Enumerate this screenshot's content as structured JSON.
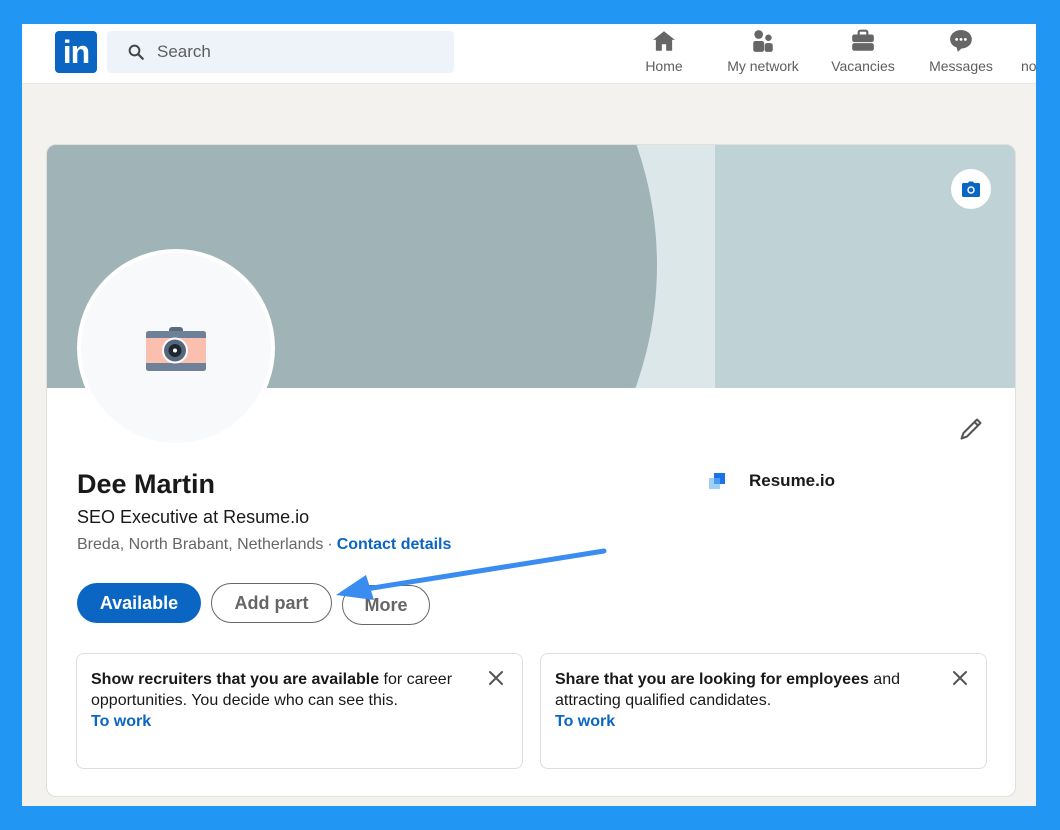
{
  "navbar": {
    "logo_text": "in",
    "search_placeholder": "Search",
    "items": [
      {
        "label": "Home",
        "icon": "home-icon"
      },
      {
        "label": "My network",
        "icon": "network-icon"
      },
      {
        "label": "Vacancies",
        "icon": "briefcase-icon"
      },
      {
        "label": "Messages",
        "icon": "messages-icon"
      },
      {
        "label": "no",
        "icon": "notifications-icon"
      }
    ]
  },
  "profile": {
    "name": "Dee Martin",
    "headline": "SEO Executive at Resume.io",
    "location": "Breda, North Brabant, Netherlands",
    "separator": "·",
    "contact_link": "Contact details",
    "company": "Resume.io",
    "actions": {
      "available": "Available",
      "add_part": "Add part",
      "more": "More"
    }
  },
  "prompts": [
    {
      "bold": "Show recruiters that you are available",
      "rest": " for career opportunities. You decide who can see this.",
      "link": "To work"
    },
    {
      "bold": "Share that you are looking for employees",
      "rest": " and attracting qualified candidates.",
      "link": "To work"
    }
  ],
  "colors": {
    "frame": "#2196f3",
    "brand": "#0a66c2",
    "annotation_arrow": "#3b8cf0"
  }
}
